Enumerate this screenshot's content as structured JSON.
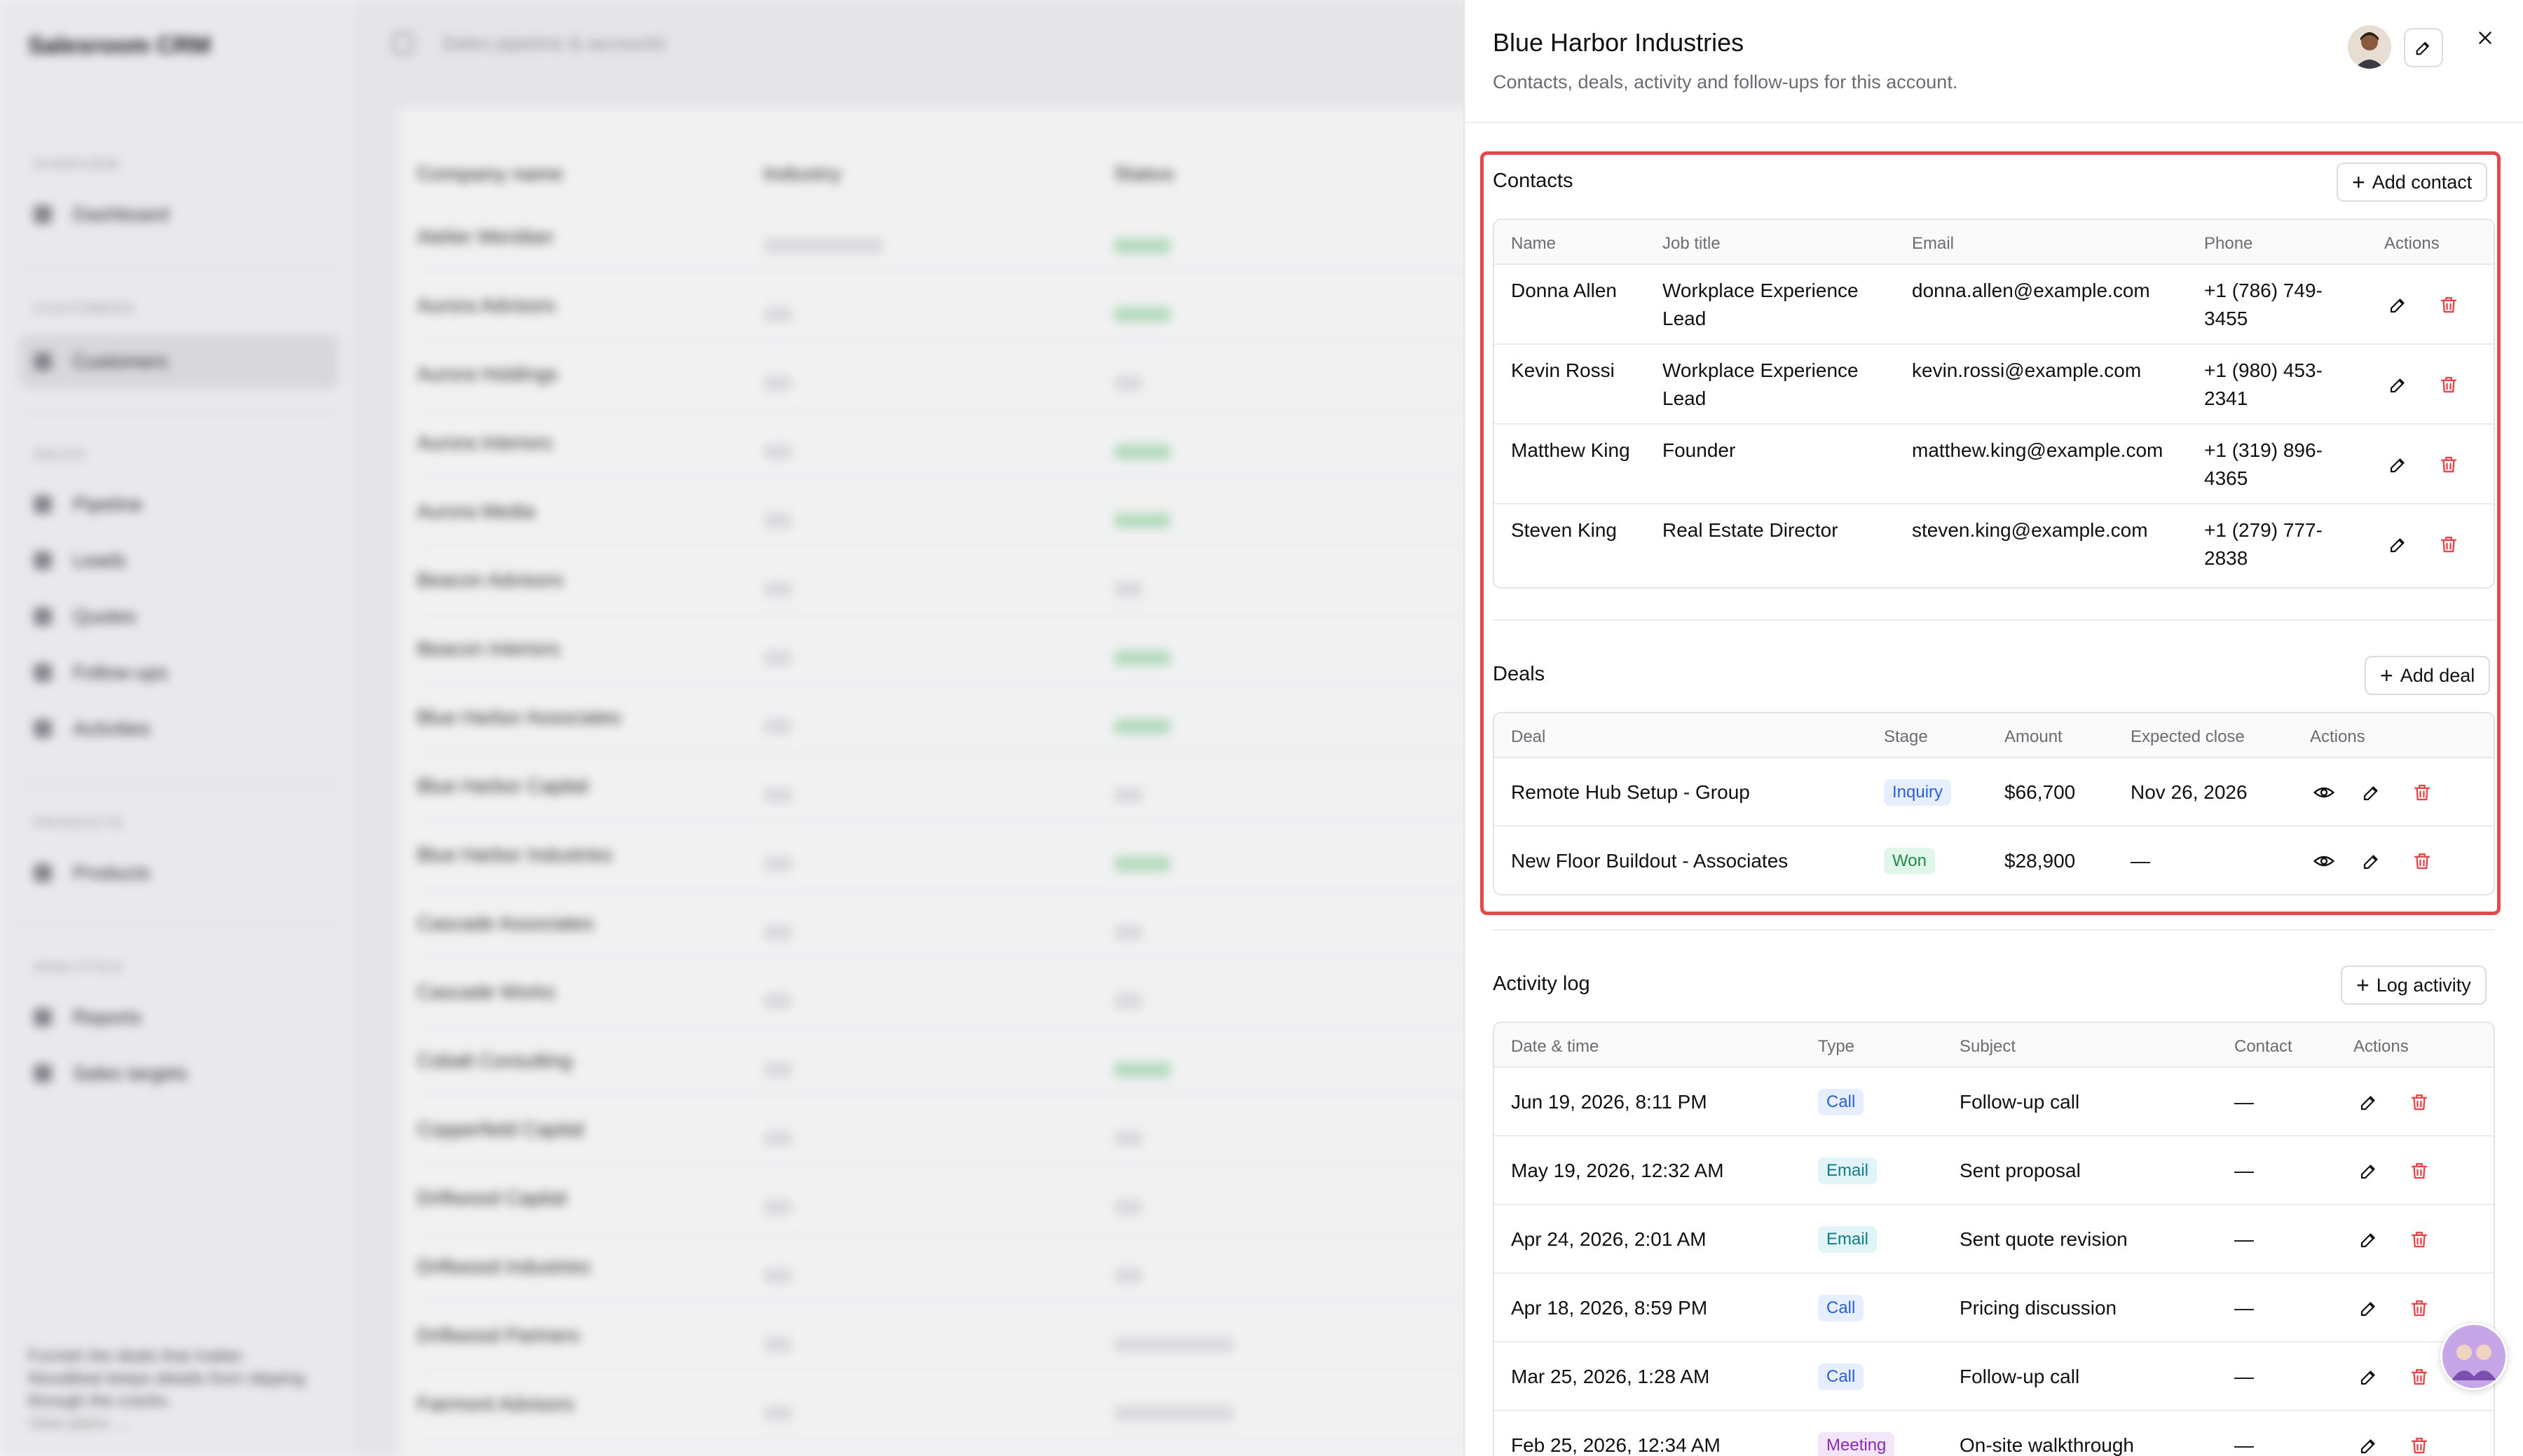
{
  "background": {
    "app_name": "Salesroom CRM",
    "breadcrumb": "Sales pipeline & accounts",
    "sidebar": {
      "groups": [
        {
          "label": "OVERVIEW",
          "items": [
            "Dashboard"
          ]
        },
        {
          "label": "CUSTOMERS",
          "items": [
            "Customers"
          ]
        },
        {
          "label": "SALES",
          "items": [
            "Pipeline",
            "Leads",
            "Quotes",
            "Follow-ups",
            "Activities"
          ]
        },
        {
          "label": "PRODUCTS",
          "items": [
            "Products"
          ]
        },
        {
          "label": "ANALYTICS",
          "items": [
            "Reports",
            "Sales targets"
          ]
        }
      ],
      "active_item": "Customers",
      "footer_text": "Furnish the deals that matter. NovaBeat keeps details from slipping through the cracks.",
      "footer_link": "View plans →"
    },
    "table_headers": [
      "Company name",
      "Industry",
      "Status"
    ],
    "companies": [
      {
        "name": "Atelier Meridian",
        "industry": "Design Studio",
        "status": "Active"
      },
      {
        "name": "Aurora Advisors",
        "industry": "—",
        "status": "Active"
      },
      {
        "name": "Aurora Holdings",
        "industry": "—",
        "status": "—"
      },
      {
        "name": "Aurora Interiors",
        "industry": "—",
        "status": "Active"
      },
      {
        "name": "Aurora Media",
        "industry": "—",
        "status": "Active"
      },
      {
        "name": "Beacon Advisors",
        "industry": "—",
        "status": "—"
      },
      {
        "name": "Beacon Interiors",
        "industry": "—",
        "status": "Active"
      },
      {
        "name": "Blue Harbor Associates",
        "industry": "—",
        "status": "Active"
      },
      {
        "name": "Blue Harbor Capital",
        "industry": "—",
        "status": "—"
      },
      {
        "name": "Blue Harbor Industries",
        "industry": "—",
        "status": "Active"
      },
      {
        "name": "Cascade Associates",
        "industry": "—",
        "status": "—"
      },
      {
        "name": "Cascade Works",
        "industry": "—",
        "status": "—"
      },
      {
        "name": "Cobalt Consulting",
        "industry": "—",
        "status": "Active"
      },
      {
        "name": "Copperfield Capital",
        "industry": "—",
        "status": "—"
      },
      {
        "name": "Driftwood Capital",
        "industry": "—",
        "status": "—"
      },
      {
        "name": "Driftwood Industries",
        "industry": "—",
        "status": "—"
      },
      {
        "name": "Driftwood Partners",
        "industry": "—",
        "status": "Inactive"
      },
      {
        "name": "Fairmont Advisors",
        "industry": "—",
        "status": "Inactive"
      }
    ]
  },
  "drawer": {
    "title": "Blue Harbor Industries",
    "subtitle": "Contacts, deals, activity and follow-ups for this account.",
    "contacts": {
      "title": "Contacts",
      "add_label": "Add contact",
      "headers": [
        "Name",
        "Job title",
        "Email",
        "Phone",
        "Actions"
      ],
      "rows": [
        {
          "name": "Donna Allen",
          "job_title": "Workplace Experience Lead",
          "email": "donna.allen@example.com",
          "phone": "+1 (786) 749-3455"
        },
        {
          "name": "Kevin Rossi",
          "job_title": "Workplace Experience Lead",
          "email": "kevin.rossi@example.com",
          "phone": "+1 (980) 453-2341"
        },
        {
          "name": "Matthew King",
          "job_title": "Founder",
          "email": "matthew.king@example.com",
          "phone": "+1 (319) 896-4365"
        },
        {
          "name": "Steven King",
          "job_title": "Real Estate Director",
          "email": "steven.king@example.com",
          "phone": "+1 (279) 777-2838"
        }
      ]
    },
    "deals": {
      "title": "Deals",
      "add_label": "Add deal",
      "headers": [
        "Deal",
        "Stage",
        "Amount",
        "Expected close",
        "Actions"
      ],
      "rows": [
        {
          "deal": "Remote Hub Setup - Group",
          "stage": "Inquiry",
          "amount": "$66,700",
          "expected_close": "Nov 26, 2026"
        },
        {
          "deal": "New Floor Buildout - Associates",
          "stage": "Won",
          "amount": "$28,900",
          "expected_close": "—"
        }
      ]
    },
    "activity": {
      "title": "Activity log",
      "add_label": "Log activity",
      "headers": [
        "Date & time",
        "Type",
        "Subject",
        "Contact",
        "Actions"
      ],
      "rows": [
        {
          "datetime": "Jun 19, 2026, 8:11 PM",
          "type": "Call",
          "subject": "Follow-up call",
          "contact": "—"
        },
        {
          "datetime": "May 19, 2026, 12:32 AM",
          "type": "Email",
          "subject": "Sent proposal",
          "contact": "—"
        },
        {
          "datetime": "Apr 24, 2026, 2:01 AM",
          "type": "Email",
          "subject": "Sent quote revision",
          "contact": "—"
        },
        {
          "datetime": "Apr 18, 2026, 8:59 PM",
          "type": "Call",
          "subject": "Pricing discussion",
          "contact": "—"
        },
        {
          "datetime": "Mar 25, 2026, 1:28 AM",
          "type": "Call",
          "subject": "Follow-up call",
          "contact": "—"
        },
        {
          "datetime": "Feb 25, 2026, 12:34 AM",
          "type": "Meeting",
          "subject": "On-site walkthrough",
          "contact": "—"
        }
      ]
    }
  },
  "colors": {
    "highlight": "#e5484d",
    "delete": "#e5484d",
    "inquiry": "#2b5fd9",
    "won": "#1f8a4c",
    "meeting": "#8a2bb8"
  }
}
